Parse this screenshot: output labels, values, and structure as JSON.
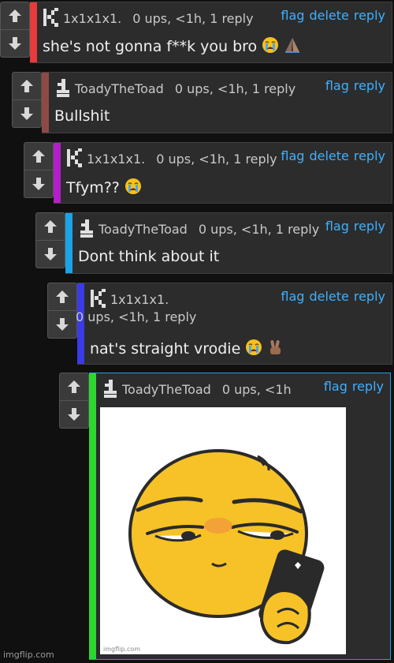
{
  "actions": {
    "flag": "flag",
    "delete": "delete",
    "reply": "reply"
  },
  "colors": {
    "c1": "#e83a3a",
    "c2": "#8b4b44",
    "c3": "#b41ec8",
    "c4": "#1aa3e6",
    "c5": "#3a3ae6",
    "c6": "#2ed62e",
    "link": "#3fb0ff"
  },
  "comments": [
    {
      "user": "1x1x1x1.",
      "meta": "0 ups, <1h, 1 reply",
      "text": "she's not gonna f**k you bro",
      "emojis": [
        "crying-face",
        "pray-hands"
      ]
    },
    {
      "user": "ToadyTheToad",
      "meta": "0 ups, <1h, 1 reply",
      "text": "Bullshit"
    },
    {
      "user": "1x1x1x1.",
      "meta": "0 ups, <1h, 1 reply",
      "text": "Tfym??",
      "emojis": [
        "crying-face"
      ]
    },
    {
      "user": "ToadyTheToad",
      "meta": "0 ups, <1h, 1 reply",
      "text": "Dont think about it"
    },
    {
      "user": "1x1x1x1.",
      "meta": "0 ups, <1h, 1 reply",
      "text": "nat's straight vrodie",
      "emojis": [
        "crying-face",
        "victory-hand"
      ]
    },
    {
      "user": "ToadyTheToad",
      "meta": "0 ups, <1h",
      "image": "smug-emoji-with-phone",
      "image_watermark": "imgflip.com"
    }
  ],
  "footer": {
    "watermark": "imgflip.com"
  }
}
